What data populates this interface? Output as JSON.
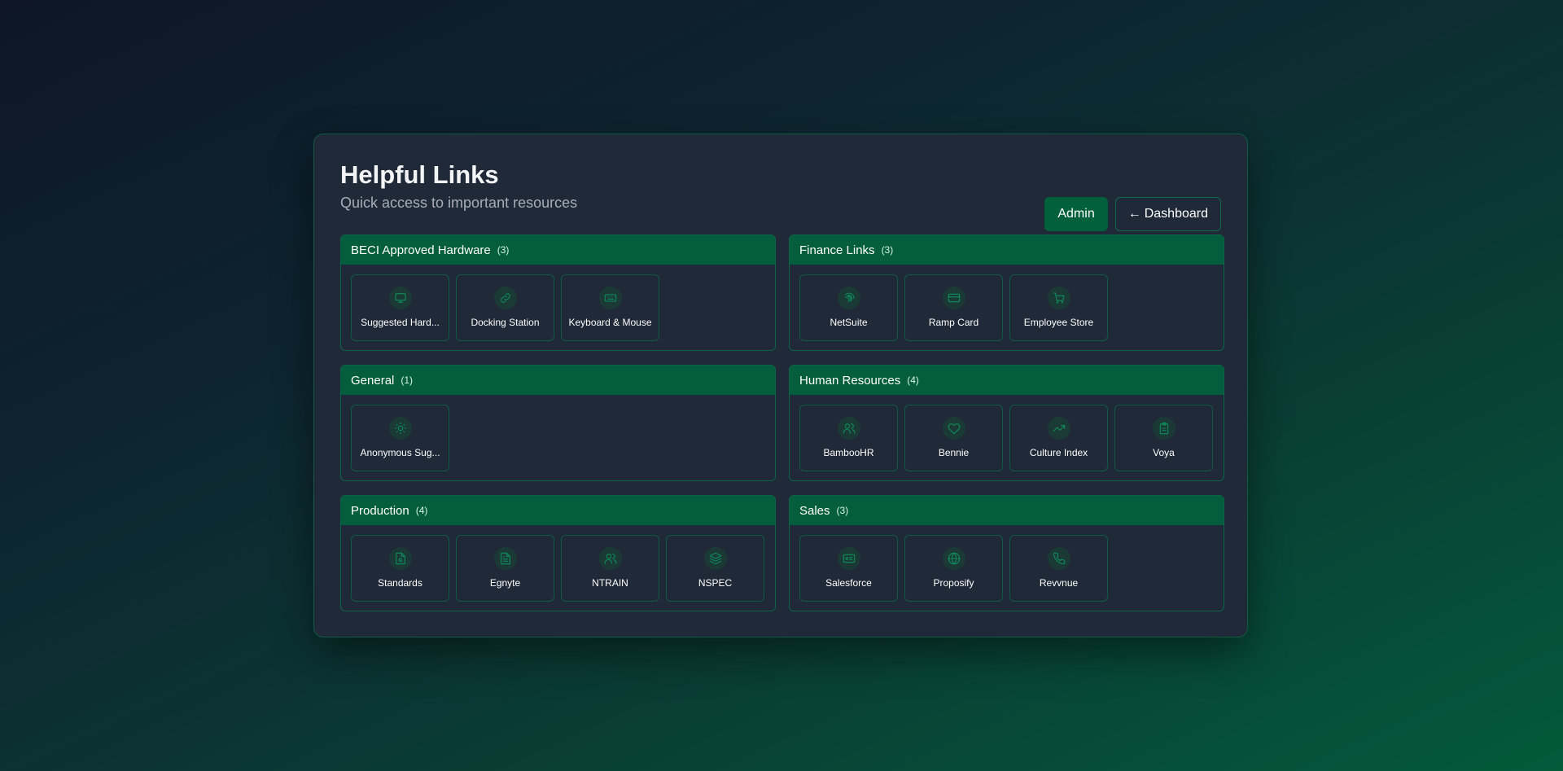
{
  "header": {
    "title": "Helpful Links",
    "subtitle": "Quick access to important resources",
    "admin_label": "Admin",
    "dashboard_arrow": "←",
    "dashboard_label": "Dashboard"
  },
  "categories": [
    {
      "name": "BECI Approved Hardware",
      "count": "(3)",
      "links": [
        {
          "label": "Suggested Hard...",
          "icon": "monitor-icon"
        },
        {
          "label": "Docking Station",
          "icon": "link-icon"
        },
        {
          "label": "Keyboard & Mouse",
          "icon": "keyboard-icon"
        }
      ]
    },
    {
      "name": "Finance Links",
      "count": "(3)",
      "links": [
        {
          "label": "NetSuite",
          "icon": "fingerprint-icon"
        },
        {
          "label": "Ramp Card",
          "icon": "credit-card-icon"
        },
        {
          "label": "Employee Store",
          "icon": "cart-icon"
        }
      ]
    },
    {
      "name": "General",
      "count": "(1)",
      "links": [
        {
          "label": "Anonymous Sug...",
          "icon": "lightbulb-icon"
        }
      ]
    },
    {
      "name": "Human Resources",
      "count": "(4)",
      "links": [
        {
          "label": "BambooHR",
          "icon": "users-icon"
        },
        {
          "label": "Bennie",
          "icon": "heart-icon"
        },
        {
          "label": "Culture Index",
          "icon": "trending-up-icon"
        },
        {
          "label": "Voya",
          "icon": "clipboard-icon"
        }
      ]
    },
    {
      "name": "Production",
      "count": "(4)",
      "links": [
        {
          "label": "Standards",
          "icon": "file-search-icon"
        },
        {
          "label": "Egnyte",
          "icon": "file-text-icon"
        },
        {
          "label": "NTRAIN",
          "icon": "users-icon"
        },
        {
          "label": "NSPEC",
          "icon": "layers-icon"
        }
      ]
    },
    {
      "name": "Sales",
      "count": "(3)",
      "links": [
        {
          "label": "Salesforce",
          "icon": "id-card-icon"
        },
        {
          "label": "Proposify",
          "icon": "globe-icon"
        },
        {
          "label": "Revvnue",
          "icon": "phone-icon"
        }
      ]
    }
  ],
  "colors": {
    "accent": "#045e3d",
    "icon": "#0e8f5c",
    "panel": "#1f2937",
    "border": "#0f5a44"
  }
}
